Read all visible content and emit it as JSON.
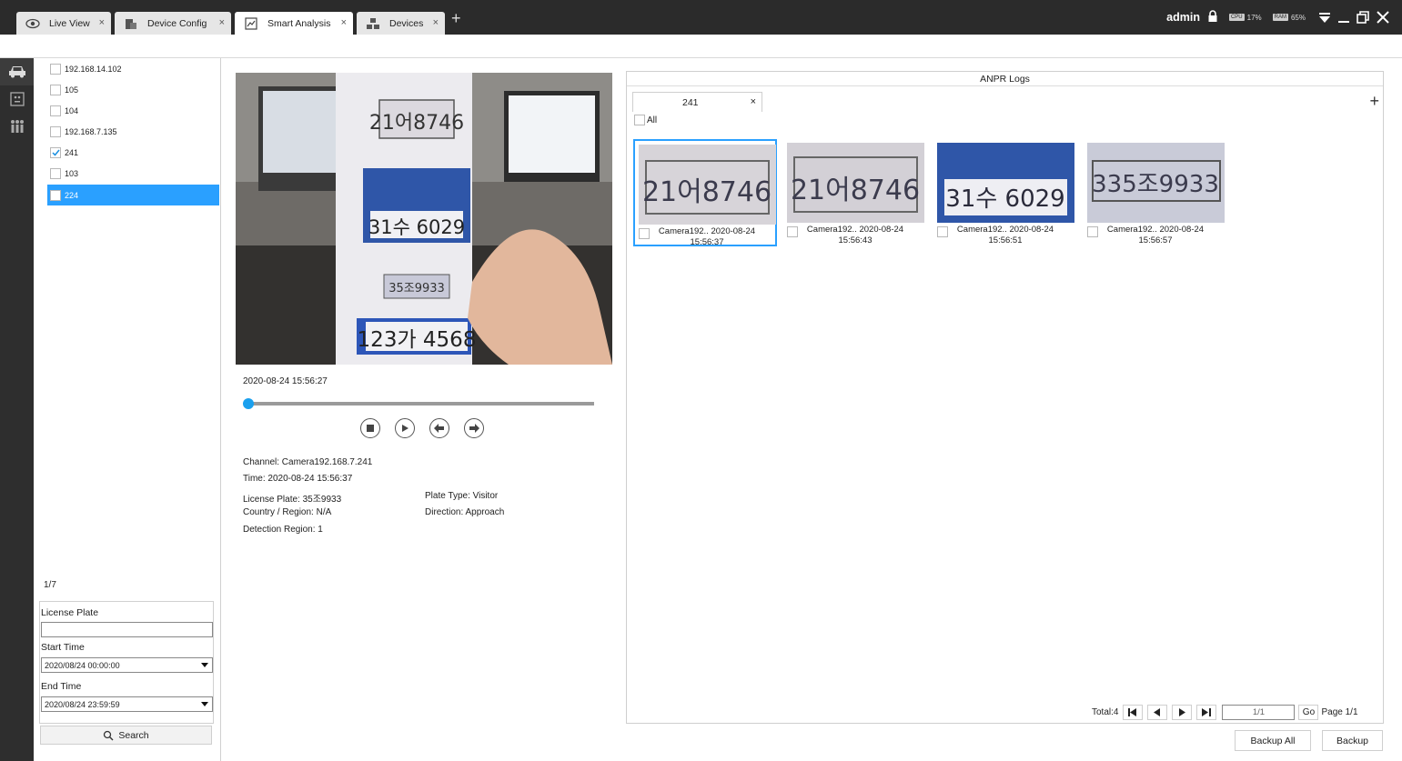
{
  "tabs": [
    {
      "label": "Live View",
      "icon": "eye-icon",
      "active": false
    },
    {
      "label": "Device Config",
      "icon": "device-config-icon",
      "active": false
    },
    {
      "label": "Smart Analysis",
      "icon": "smart-analysis-icon",
      "active": true
    },
    {
      "label": "Devices",
      "icon": "devices-icon",
      "active": false
    }
  ],
  "tab_close_glyph": "×",
  "add_tab_glyph": "+",
  "status": {
    "user": "admin",
    "cpu_label": "CPU",
    "cpu_value": "17%",
    "ram_label": "RAM",
    "ram_value": "65%"
  },
  "left_nav": [
    "car-icon",
    "face-icon",
    "people-counting-icon"
  ],
  "devices": [
    {
      "name": "192.168.14.102",
      "checked": false,
      "selected": false
    },
    {
      "name": "105",
      "checked": false,
      "selected": false
    },
    {
      "name": "104",
      "checked": false,
      "selected": false
    },
    {
      "name": "192.168.7.135",
      "checked": false,
      "selected": false
    },
    {
      "name": "241",
      "checked": true,
      "selected": false
    },
    {
      "name": "103",
      "checked": false,
      "selected": false
    },
    {
      "name": "224",
      "checked": false,
      "selected": true
    }
  ],
  "device_page": "1/7",
  "filter": {
    "plate_label": "License Plate",
    "plate_value": "",
    "start_label": "Start Time",
    "start_value": "2020/08/24 00:00:00",
    "end_label": "End Time",
    "end_value": "2020/08/24 23:59:59",
    "search_label": "Search"
  },
  "player": {
    "timestamp": "2020-08-24 15:56:27",
    "progress": 0.0
  },
  "details": {
    "channel": "Channel: Camera192.168.7.241",
    "time": "Time: 2020-08-24 15:56:37",
    "plate": "License Plate: 35조9933",
    "plate_type": "Plate Type: Visitor",
    "region": "Country / Region: N/A",
    "direction": "Direction: Approach",
    "detection": "Detection Region: 1"
  },
  "video_plates": [
    "21어8746",
    "31수 6029",
    "35조9933",
    "123가 4568"
  ],
  "logs": {
    "title": "ANPR Logs",
    "tab_label": "241",
    "all_label": "All",
    "items": [
      {
        "plate": "21어8746",
        "cap1": "Camera192.. 2020-08-24",
        "cap2": "15:56:37",
        "selected": true,
        "bg": "#d7d4d9"
      },
      {
        "plate": "21어8746",
        "cap1": "Camera192.. 2020-08-24",
        "cap2": "15:56:43",
        "selected": false,
        "bg": "#d3d0d6"
      },
      {
        "plate": "31수 6029",
        "cap1": "Camera192.. 2020-08-24",
        "cap2": "15:56:51",
        "selected": false,
        "bg": "#e9e9ef"
      },
      {
        "plate": "335조9933",
        "cap1": "Camera192.. 2020-08-24",
        "cap2": "15:56:57",
        "selected": false,
        "bg": "#c9cbd8"
      }
    ],
    "total": "Total:4",
    "page_input": "1/1",
    "go_label": "Go",
    "page_label": "Page 1/1"
  },
  "buttons": {
    "backup_all": "Backup All",
    "backup": "Backup"
  },
  "colors": {
    "accent": "#2aa0ff",
    "topbar": "#2b2b2b",
    "sidebar": "#2e2e2e"
  }
}
